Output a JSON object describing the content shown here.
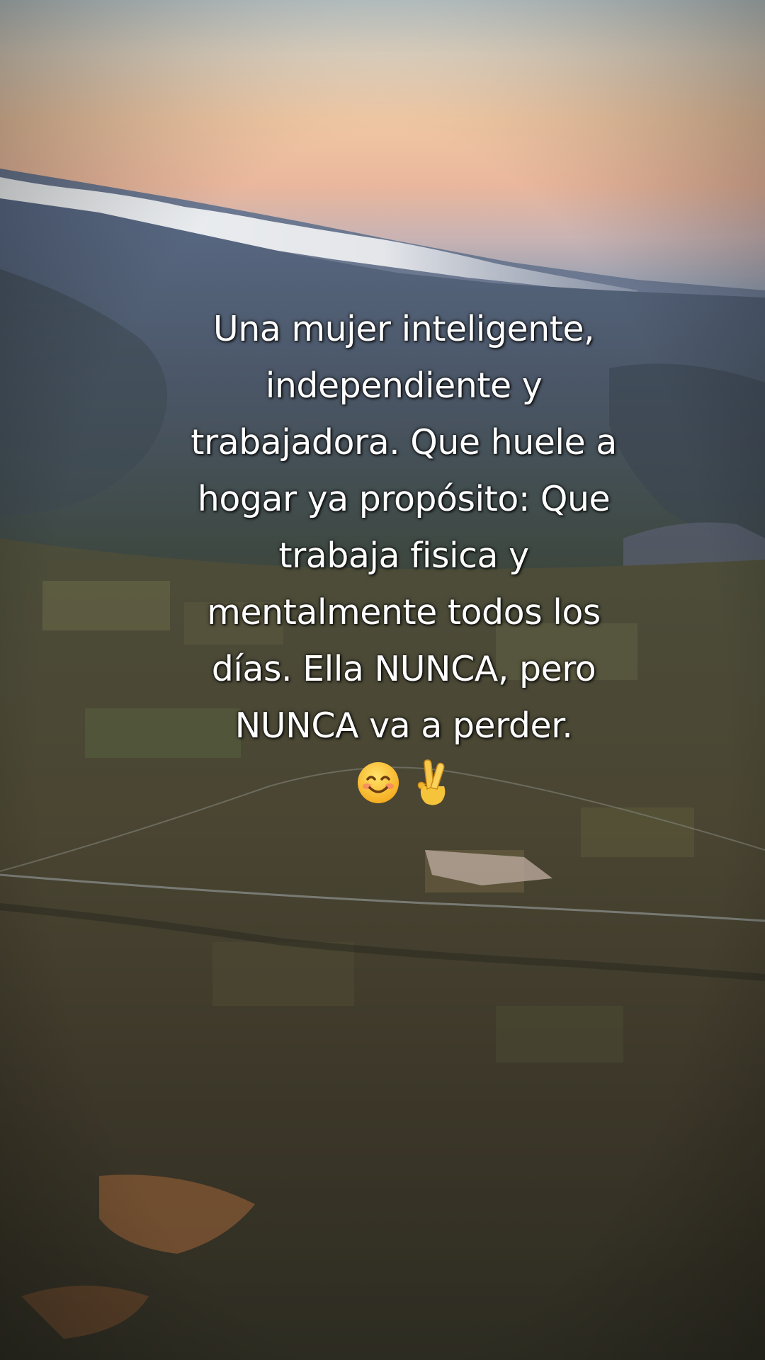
{
  "caption": {
    "lines": [
      "Una mujer inteligente,",
      "independiente y",
      "trabajadora. Que huele a",
      "hogar ya propósito: Que",
      "trabaja fisica y",
      "mentalmente todos los",
      "días. Ella NUNCA, pero",
      "NUNCA va a perder."
    ],
    "emojis": [
      "smiling-face-icon",
      "crossed-fingers-icon"
    ]
  },
  "colors": {
    "text": "#ffffff",
    "sky_top": "#c8d3d4",
    "sky_glow": "#f0c8a4",
    "valley": "#4a4a34"
  }
}
